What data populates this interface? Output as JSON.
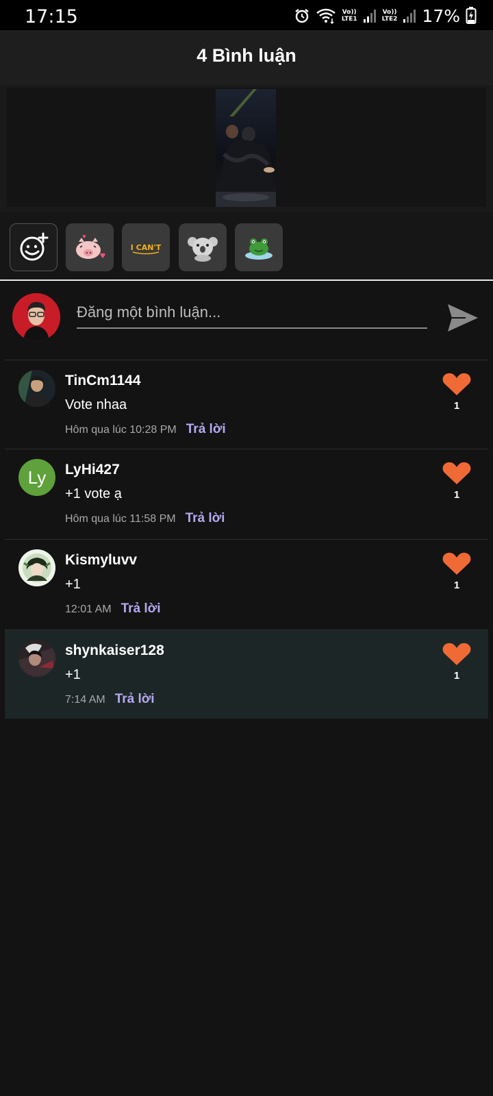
{
  "status_bar": {
    "time": "17:15",
    "sim1_label": "Vo))\nLTE1",
    "sim2_label": "Vo))\nLTE2",
    "battery": "17%"
  },
  "header": {
    "title": "4 Bình luận"
  },
  "composer": {
    "placeholder": "Đăng một bình luận..."
  },
  "stickers": [
    "add-sticker-icon",
    "pig-sticker",
    "i-cant-sticker",
    "koala-sticker",
    "frog-sticker"
  ],
  "sticker_text": {
    "i_cant": "I CAN'T"
  },
  "comments": [
    {
      "user": "TinCm1144",
      "text": "Vote nhaa",
      "time": "Hôm qua lúc 10:28 PM",
      "reply": "Trả lời",
      "likes": "1",
      "avatar_letter": ""
    },
    {
      "user": "LyHi427",
      "text": "+1 vote ạ",
      "time": "Hôm qua lúc 11:58 PM",
      "reply": "Trả lời",
      "likes": "1",
      "avatar_letter": "Ly"
    },
    {
      "user": "Kismyluvv",
      "text": "+1",
      "time": "12:01 AM",
      "reply": "Trả lời",
      "likes": "1",
      "avatar_letter": ""
    },
    {
      "user": "shynkaiser128",
      "text": "+1",
      "time": "7:14 AM",
      "reply": "Trả lời",
      "likes": "1",
      "avatar_letter": ""
    }
  ],
  "colors": {
    "accent_reply": "#b7a9ef",
    "heart": "#f06a35",
    "highlight_row": "#1d2627",
    "letter_avatar": "#5fa13a"
  }
}
